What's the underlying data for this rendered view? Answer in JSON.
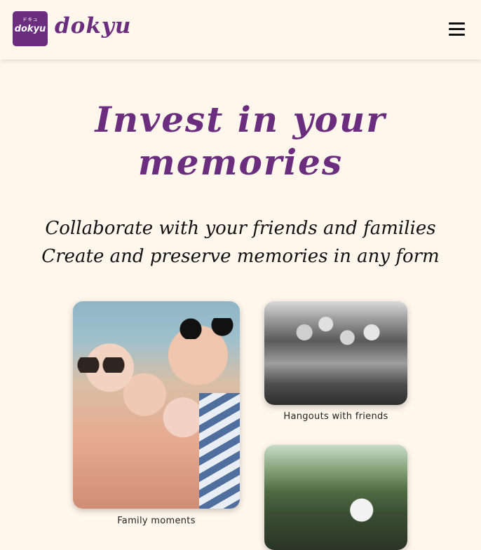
{
  "header": {
    "logo_kana": "ドキュ",
    "logo_mini_text": "dokyu",
    "brand_name": "dokyu",
    "menu_icon": "hamburger-menu-icon"
  },
  "hero": {
    "headline_line1": "Invest in your",
    "headline_line2": "memories",
    "subhead_line1": "Collaborate with your friends and families",
    "subhead_line2": "Create and preserve memories in any form"
  },
  "gallery": {
    "items": [
      {
        "caption": "Family moments"
      },
      {
        "caption": "Hangouts with friends"
      },
      {
        "caption": ""
      }
    ]
  },
  "colors": {
    "brand_purple": "#6b2d7e",
    "background": "#fff6ec",
    "text": "#111111"
  }
}
